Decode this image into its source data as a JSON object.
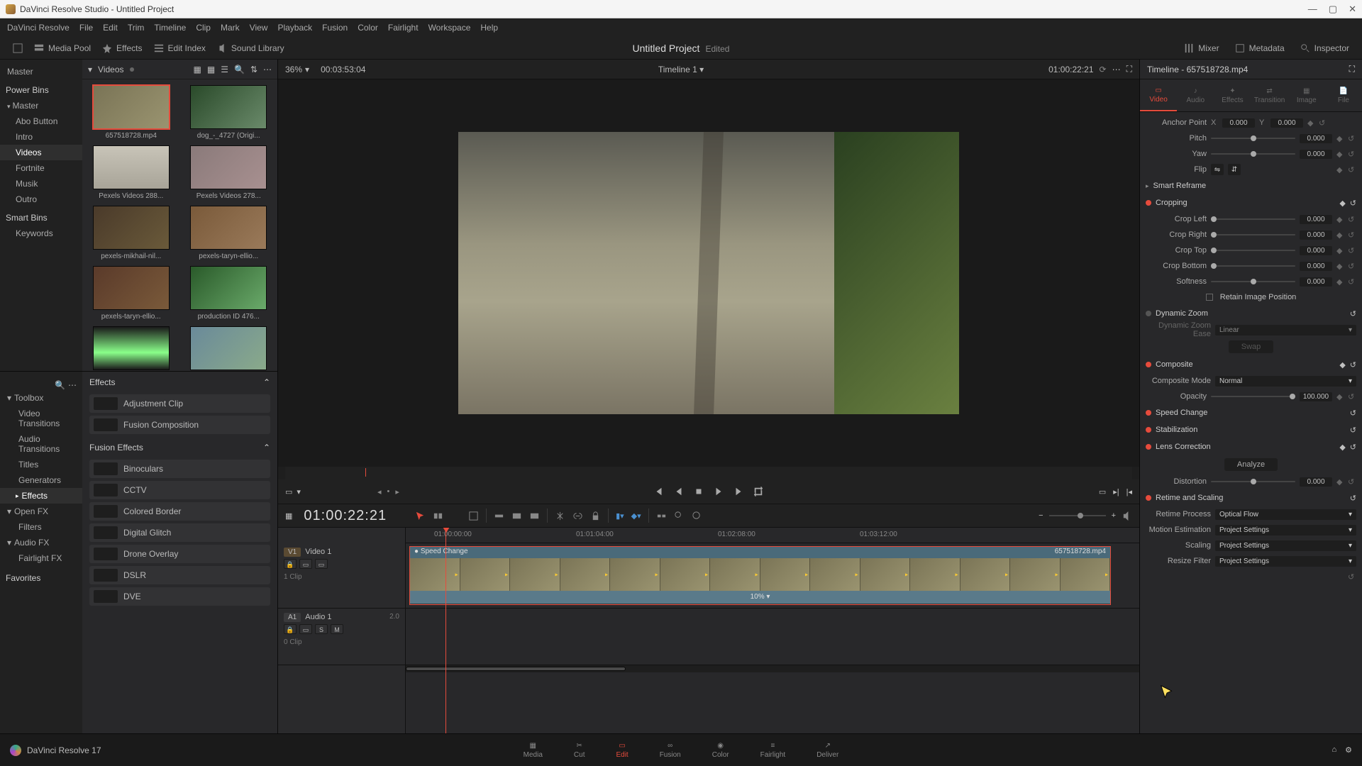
{
  "title": "DaVinci Resolve Studio - Untitled Project",
  "menu": [
    "DaVinci Resolve",
    "File",
    "Edit",
    "Trim",
    "Timeline",
    "Clip",
    "Mark",
    "View",
    "Playback",
    "Fusion",
    "Color",
    "Fairlight",
    "Workspace",
    "Help"
  ],
  "top_toggles": {
    "media_pool": "Media Pool",
    "effects": "Effects",
    "edit_index": "Edit Index",
    "sound_library": "Sound Library",
    "mixer": "Mixer",
    "metadata": "Metadata",
    "inspector": "Inspector"
  },
  "project_title": "Untitled Project",
  "project_status": "Edited",
  "bin": {
    "master": "Master",
    "power_bins_header": "Power Bins",
    "power_bins": [
      "Master",
      "Abo Button",
      "Intro",
      "Videos",
      "Fortnite",
      "Musik",
      "Outro"
    ],
    "active": "Videos",
    "smart_header": "Smart Bins",
    "smart": [
      "Keywords"
    ]
  },
  "clips_panel": {
    "folder": "Videos",
    "clips": [
      {
        "label": "657518728.mp4",
        "selected": true,
        "bg": "linear-gradient(135deg,#7a7456,#9a9470)"
      },
      {
        "label": "dog_-_4727 (Origi...",
        "bg": "linear-gradient(135deg,#2a4a2a,#6a8a6a)"
      },
      {
        "label": "Pexels Videos 288...",
        "bg": "linear-gradient(#c8c4b8,#a8a498)"
      },
      {
        "label": "Pexels Videos 278...",
        "bg": "linear-gradient(135deg,#8a7a7a,#a89090)"
      },
      {
        "label": "pexels-mikhail-nil...",
        "bg": "linear-gradient(135deg,#4a3a2a,#6a5a3a)"
      },
      {
        "label": "pexels-taryn-ellio...",
        "bg": "linear-gradient(135deg,#7a5a3a,#9a7a5a)"
      },
      {
        "label": "pexels-taryn-ellio...",
        "bg": "linear-gradient(135deg,#5a3a2a,#7a5a3a)"
      },
      {
        "label": "production ID 476...",
        "bg": "linear-gradient(135deg,#2a5a2a,#6aaa6a)"
      },
      {
        "label": "",
        "bg": "linear-gradient(#1a1a1a,#8aff8a 60%,#1a1a1a)"
      },
      {
        "label": "",
        "bg": "linear-gradient(135deg,#6a8a9a,#8aaa8a)"
      }
    ]
  },
  "fx_tree": {
    "toolbox": "Toolbox",
    "toolbox_items": [
      "Video Transitions",
      "Audio Transitions",
      "Titles",
      "Generators",
      "Effects"
    ],
    "toolbox_active": "Effects",
    "openfx": "Open FX",
    "filters": "Filters",
    "audiofx": "Audio FX",
    "fairlight": "Fairlight FX",
    "favorites": "Favorites"
  },
  "fx_list": {
    "header1": "Effects",
    "items1": [
      "Adjustment Clip",
      "Fusion Composition"
    ],
    "header2": "Fusion Effects",
    "items2": [
      "Binoculars",
      "CCTV",
      "Colored Border",
      "Digital Glitch",
      "Drone Overlay",
      "DSLR",
      "DVE"
    ]
  },
  "viewer": {
    "zoom": "36%",
    "src_tc": "00:03:53:04",
    "title": "Timeline 1",
    "rec_tc": "01:00:22:21"
  },
  "timeline": {
    "tc": "01:00:22:21",
    "ticks": [
      "01:00:00:00",
      "01:01:04:00",
      "01:02:08:00",
      "01:03:12:00"
    ],
    "video_track": {
      "tag": "V1",
      "name": "Video 1",
      "clips": "1 Clip"
    },
    "audio_track": {
      "tag": "A1",
      "name": "Audio 1",
      "ch": "2.0",
      "clips": "0 Clip",
      "solo": "S",
      "mute": "M"
    },
    "clip": {
      "speed_label": "Speed Change",
      "name": "657518728.mp4",
      "speed": "10% ▾"
    }
  },
  "inspector": {
    "title": "Timeline - 657518728.mp4",
    "tabs": [
      "Video",
      "Audio",
      "Effects",
      "Transition",
      "Image",
      "File"
    ],
    "active": "Video",
    "anchor": {
      "label": "Anchor Point",
      "x": "0.000",
      "y": "0.000"
    },
    "pitch": {
      "label": "Pitch",
      "val": "0.000"
    },
    "yaw": {
      "label": "Yaw",
      "val": "0.000"
    },
    "flip": {
      "label": "Flip"
    },
    "smart_reframe": "Smart Reframe",
    "cropping": {
      "title": "Cropping",
      "left": {
        "label": "Crop Left",
        "val": "0.000"
      },
      "right": {
        "label": "Crop Right",
        "val": "0.000"
      },
      "top": {
        "label": "Crop Top",
        "val": "0.000"
      },
      "bottom": {
        "label": "Crop Bottom",
        "val": "0.000"
      },
      "soft": {
        "label": "Softness",
        "val": "0.000"
      },
      "retain": "Retain Image Position"
    },
    "dyn_zoom": {
      "title": "Dynamic Zoom",
      "ease_label": "Dynamic Zoom Ease",
      "ease": "Linear",
      "swap": "Swap"
    },
    "composite": {
      "title": "Composite",
      "mode_label": "Composite Mode",
      "mode": "Normal",
      "opacity_label": "Opacity",
      "opacity": "100.000"
    },
    "speed_change": "Speed Change",
    "stabilization": "Stabilization",
    "lens": {
      "title": "Lens Correction",
      "analyze": "Analyze",
      "dist_label": "Distortion",
      "dist": "0.000"
    },
    "retime": {
      "title": "Retime and Scaling",
      "process_label": "Retime Process",
      "process": "Optical Flow",
      "motion_label": "Motion Estimation",
      "motion": "Project Settings",
      "scaling_label": "Scaling",
      "scaling": "Project Settings",
      "resize_label": "Resize Filter",
      "resize": "Project Settings"
    }
  },
  "page_nav": {
    "items": [
      "Media",
      "Cut",
      "Edit",
      "Fusion",
      "Color",
      "Fairlight",
      "Deliver"
    ],
    "active": "Edit",
    "status": "DaVinci Resolve 17"
  }
}
